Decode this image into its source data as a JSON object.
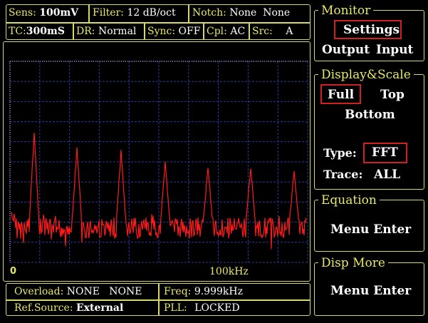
{
  "status_bar": {
    "sens_label": "Sens:",
    "sens_value": "100mV",
    "filter_label": "Filter:",
    "filter_value": "12 dB/oct",
    "notch_label": "Notch:",
    "notch_value": "None  None",
    "tc_label": "TC:",
    "tc_value": "300mS",
    "dr_label": "DR:",
    "dr_value": "Normal",
    "sync_label": "Sync:",
    "sync_value": "OFF",
    "cpl_label": "Cpl:",
    "cpl_value": "AC",
    "src_label": "Src:",
    "src_value": "A"
  },
  "plot": {
    "x_start_label": "0",
    "x_mid_label": "100kHz"
  },
  "bottom_status": {
    "overload_label": "Overload:",
    "overload_value": "NONE   NONE",
    "freq_label": "Freq:",
    "freq_value": "9.999kHz",
    "refsource_label": "Ref.Source:",
    "refsource_value": "External",
    "pll_label": "PLL:",
    "pll_value": "LOCKED"
  },
  "menu": {
    "monitor": {
      "title": "Monitor",
      "settings": "Settings",
      "output": "Output",
      "input": "Input"
    },
    "display_scale": {
      "title": "Display&Scale",
      "full": "Full",
      "top": "Top",
      "bottom": "Bottom",
      "type_label": "Type:",
      "type_value": "FFT",
      "trace_label": "Trace:",
      "trace_value": "ALL"
    },
    "equation": {
      "title": "Equation",
      "menu_enter": "Menu Enter"
    },
    "disp_more": {
      "title": "Disp More",
      "menu_enter": "Menu Enter"
    }
  },
  "colors": {
    "frame": "#d8d86a",
    "label": "#e8e86a",
    "grid": "#2a3a9a",
    "trace": "#ff1a1a",
    "selection": "#d02020"
  }
}
